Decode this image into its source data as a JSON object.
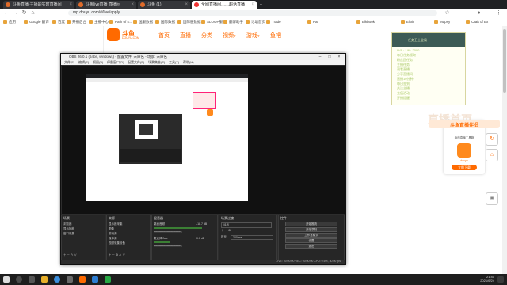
{
  "browser": {
    "tabs": [
      {
        "label": "斗鱼直播-主播的实时直播间",
        "active": false
      },
      {
        "label": "斗鱼live直播 直播间",
        "active": false
      },
      {
        "label": "斗鱼 (1)",
        "active": false
      },
      {
        "label": "全网直播间……超话直播",
        "active": true
      }
    ],
    "url": "mp.douyu.com/#/live/apply",
    "bookmarks": [
      "应用",
      "Google 翻译",
      "百度",
      "开播后台",
      "主播中心",
      "Path of E...",
      "国服数据",
      "国际数据",
      "国际服数据",
      "SLOOP服务",
      "翻译助手",
      "论坛首页",
      "Trade",
      "Par",
      "Elkbook",
      "Elixir",
      "Mapsy",
      "Craft of Ex"
    ]
  },
  "site": {
    "logo_text": "斗鱼",
    "logo_sub": "DOUYU.COM",
    "nav": [
      "首页",
      "直播",
      "分类",
      "视频",
      "游戏",
      "鱼吧"
    ],
    "faded_text": "直播首页"
  },
  "overlay": {
    "header": "任务卫士全局",
    "lines": [
      "LV6 · 1/6 · 2000",
      "每日任务领取",
      "粉丝团任务",
      "主播任务",
      "观看直播",
      "分享直播间",
      "直播10分钟",
      "每日签到",
      "关注主播",
      "充值活动",
      "开播提醒",
      "更多奖励"
    ]
  },
  "ad": {
    "title": "斗鱼直播伴侣",
    "line1": "我的直播工具箱",
    "line2": "douyu",
    "button": "立即下载"
  },
  "obs": {
    "title": "OBS 26.0.1 (64bit, windows) - 配置文件: 未命名 - 场景: 未命名",
    "menu": [
      "文件(F)",
      "编辑(E)",
      "视图(V)",
      "停靠窗口(D)",
      "配置文件(P)",
      "场景集合(S)",
      "工具(T)",
      "帮助(H)"
    ],
    "docks": {
      "scenes": {
        "title": "场景",
        "items": [
          "浏览器",
          "显示捕获",
          "窗口采集"
        ]
      },
      "sources": {
        "title": "来源",
        "items": [
          "显示器采集",
          "图像",
          "游戏源",
          "媒体源",
          "视频采集设备"
        ]
      },
      "mixer": {
        "title": "混音器",
        "items": [
          "桌面音频",
          "麦克风/Aux"
        ],
        "levels": [
          "-18.7 dB",
          "0.0 dB"
        ]
      },
      "transitions": {
        "title": "场景过渡",
        "type": "淡出",
        "duration_label": "时长",
        "duration": "300 ms"
      },
      "controls": {
        "title": "控件",
        "buttons": [
          "开始推流",
          "开始录制",
          "工作室模式",
          "设置",
          "退出"
        ]
      }
    },
    "status": "LIVE: 00:00:00  REC: 00:00:00  CPU: 0.6%, 30.00 fps"
  },
  "taskbar": {
    "time": "21:40",
    "date": "2021/6/24"
  }
}
